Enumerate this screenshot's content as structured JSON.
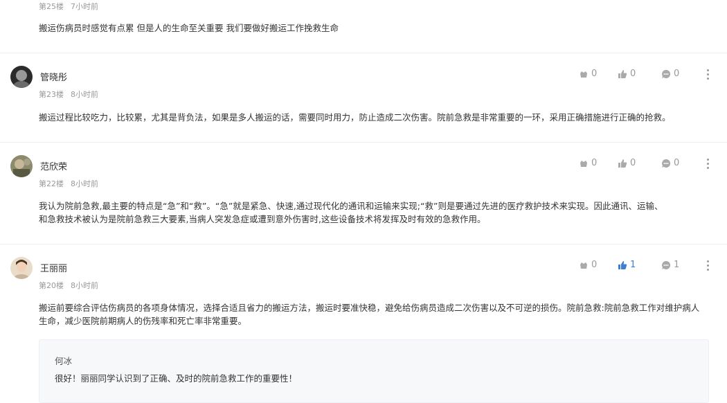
{
  "top_comment": {
    "floor": "第25楼",
    "time": "7小时前",
    "text": "搬运伤病员时感觉有点累 但是人的生命至关重要 我们要做好搬运工作挽救生命"
  },
  "comments": [
    {
      "name": "管晓彤",
      "floor": "第23楼",
      "time": "8小时前",
      "flowers": "0",
      "likes": "0",
      "replies": "0",
      "text": "搬运过程比较吃力，比较累，尤其是背负法，如果是多人搬运的话，需要同时用力，防止造成二次伤害。院前急救是非常重要的一环，采用正确措施进行正确的抢救。"
    },
    {
      "name": "范欣荣",
      "floor": "第22楼",
      "time": "8小时前",
      "flowers": "0",
      "likes": "0",
      "replies": "0",
      "text_line1": "我认为院前急救,最主要的特点是“急”和“救”。“急”就是紧急、快速,通过现代化的通讯和运输来实现;“救”则是要通过先进的医疗救护技术来实现。因此通讯、运输、",
      "text_line2": "和急救技术被认为是院前急救三大要素,当病人突发急症或遭到意外伤害时,这些设备技术将发挥及时有效的急救作用。"
    },
    {
      "name": "王丽丽",
      "floor": "第20楼",
      "time": "8小时前",
      "flowers": "0",
      "likes": "1",
      "replies": "1",
      "text_line1": "搬运前要综合评估伤病员的各项身体情况，选择合适且省力的搬运方法，搬运时要准快稳，避免给伤病员造成二次伤害以及不可逆的损伤。院前急救:院前急救工作对维护病人",
      "text_line2": "生命，减少医院前期病人的伤残率和死亡率非常重要。",
      "reply": {
        "name": "何冰",
        "text": "很好！丽丽同学认识到了正确、及时的院前急救工作的重要性！"
      }
    }
  ],
  "colors": {
    "accent": "#3d7fd6",
    "muted": "#999999"
  }
}
